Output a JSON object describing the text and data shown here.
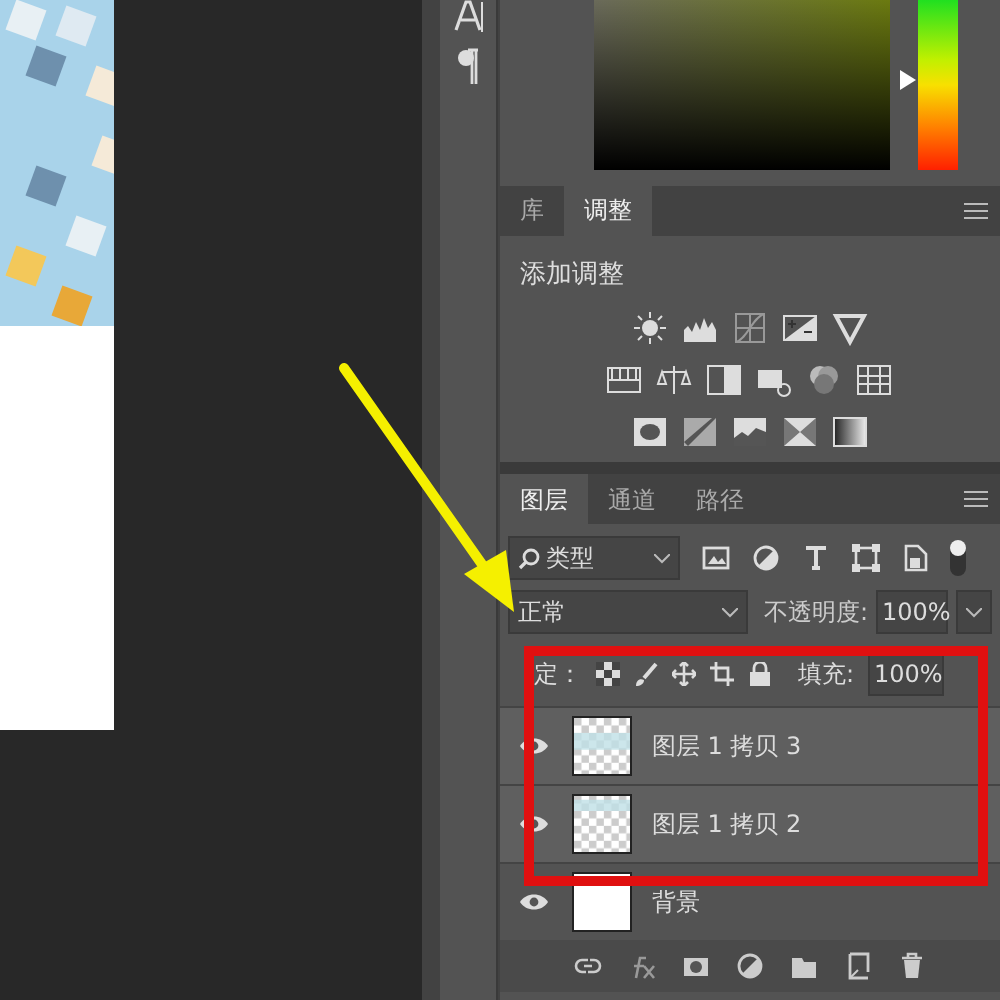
{
  "color_picker": {
    "hue_slider": {
      "level": 0.53
    }
  },
  "adjustments_panel": {
    "tabs": [
      {
        "label": "库",
        "selected": false
      },
      {
        "label": "调整",
        "selected": true
      }
    ],
    "heading": "添加调整"
  },
  "layers_panel": {
    "tabs": [
      {
        "label": "图层",
        "selected": true
      },
      {
        "label": "通道",
        "selected": false
      },
      {
        "label": "路径",
        "selected": false
      }
    ],
    "filter": {
      "value": "类型"
    },
    "blend_mode": "正常",
    "opacity_label": "不透明度:",
    "opacity": "100%",
    "lock_label": "定：",
    "fill_label": "填充:",
    "fill": "100%",
    "layers": [
      {
        "name": "图层 1 拷贝 3",
        "visible": true,
        "selected": true,
        "kind": "transparent"
      },
      {
        "name": "图层 1 拷贝 2",
        "visible": true,
        "selected": true,
        "kind": "transparent"
      },
      {
        "name": "背景",
        "visible": true,
        "selected": false,
        "kind": "white"
      }
    ]
  }
}
